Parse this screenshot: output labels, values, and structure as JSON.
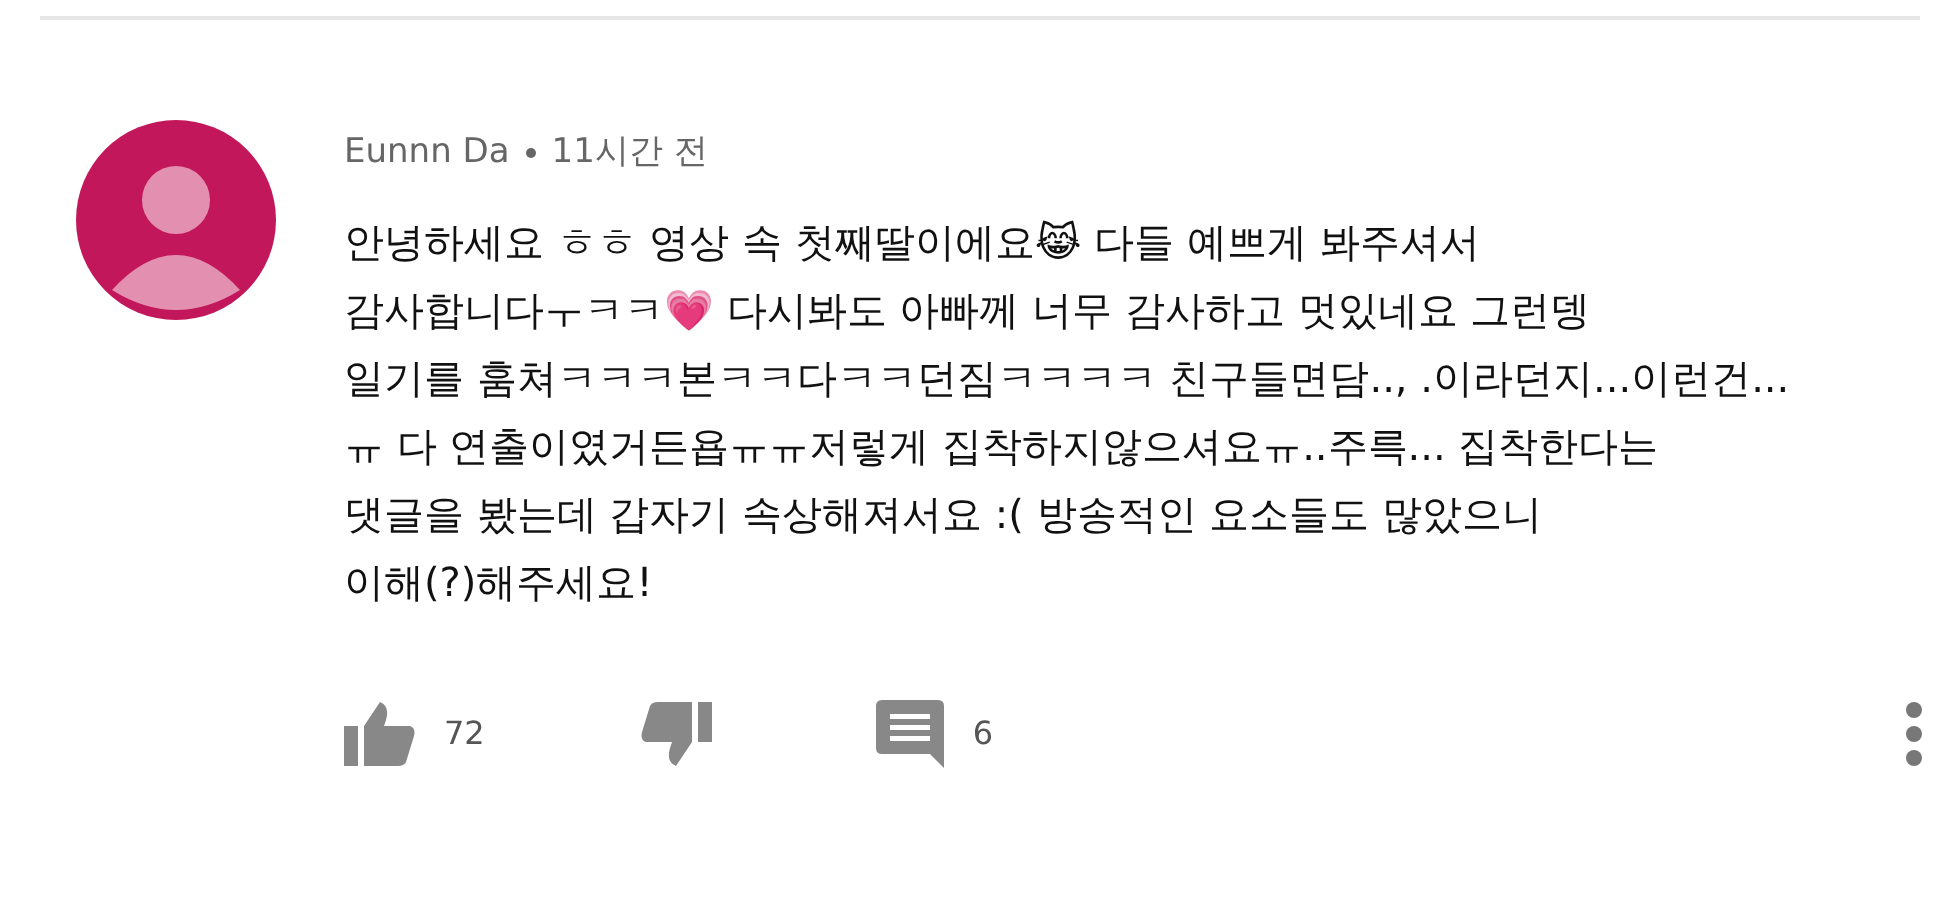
{
  "comment": {
    "author": "Eunnn Da",
    "time": "11시간 전",
    "lines": [
      "안녕하세요 ㅎㅎ 영상 속 첫째딸이에요😹 다들 예쁘게 봐주셔서",
      "감사합니다ㅜㅋㅋ💗 다시봐도 아빠께 너무 감사하고 멋있네요 그런뎅",
      "일기를 훔쳐ㅋㅋㅋ본ㅋㅋ다ㅋㅋ던짐ㅋㅋㅋㅋ 친구들면담.., .이라던지...이런건...",
      "ㅠ 다 연출이였거든욥ㅠㅠ저렇게 집착하지않으셔요ㅠ..주륵... 집착한다는",
      "댓글을 봤는데 갑자기 속상해져서요 :( 방송적인 요소들도 많았으니",
      "이해(?)해주세요!"
    ],
    "likes": "72",
    "replies": "6"
  }
}
